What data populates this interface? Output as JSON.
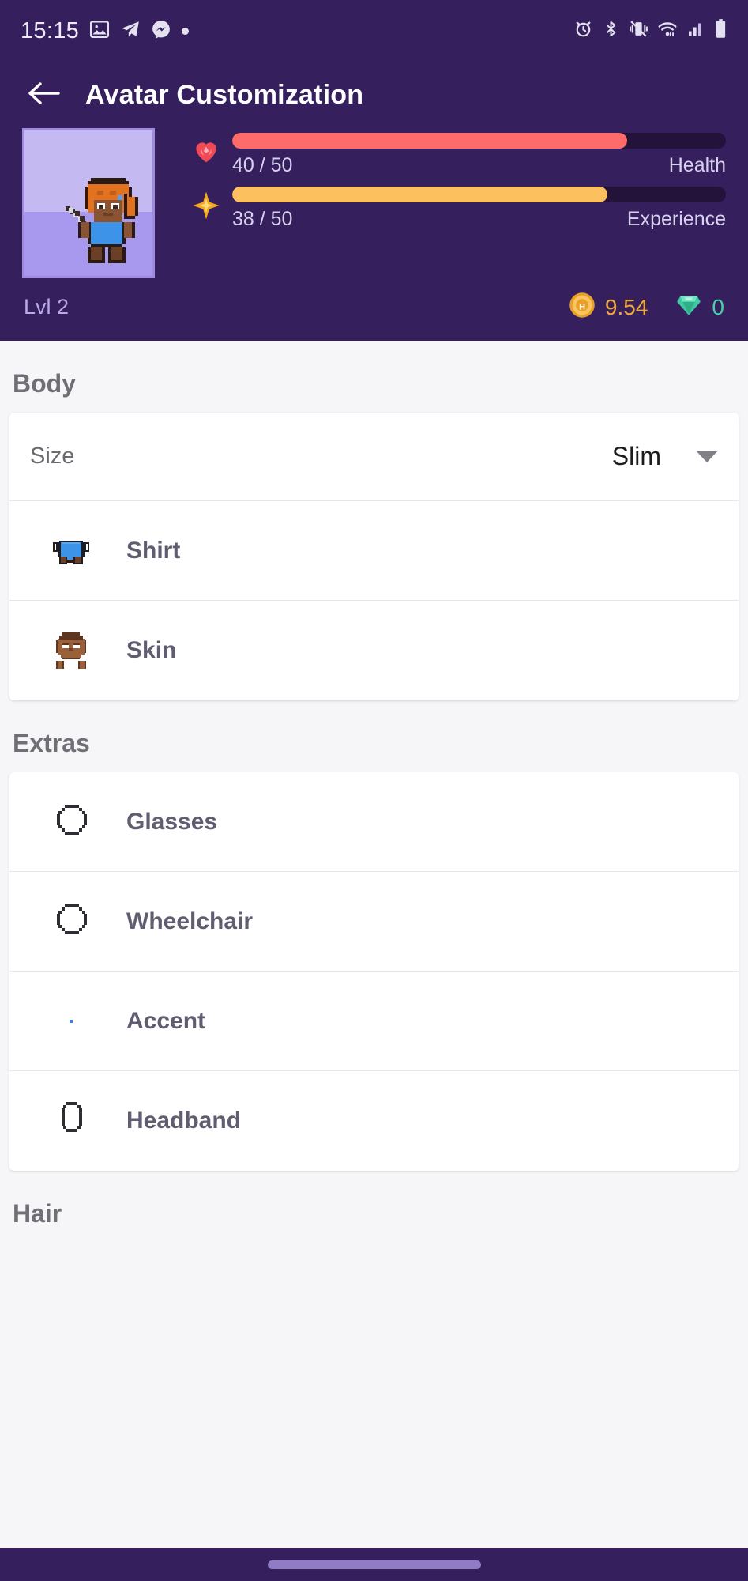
{
  "status_bar": {
    "time": "15:15",
    "left_icons": [
      "photos-icon",
      "telegram-icon",
      "messenger-icon",
      "dot-icon"
    ],
    "right_icons": [
      "alarm-icon",
      "bluetooth-icon",
      "vibrate-icon",
      "wifi-icon",
      "signal-icon",
      "battery-icon"
    ]
  },
  "header": {
    "back_icon": "back-arrow-icon",
    "title": "Avatar Customization",
    "background_color": "#35205d",
    "avatar": {
      "name": "avatar-preview",
      "border_color": "#9f8ae0",
      "bg_top_color": "#c5b9f2",
      "bg_bottom_color": "#a899ee"
    },
    "stats": [
      {
        "icon": "heart-icon",
        "value_text": "40 / 50",
        "label": "Health",
        "current": 40,
        "max": 50,
        "percent": 80,
        "fill_color": "#ff6b6b",
        "track_color": "#231239"
      },
      {
        "icon": "sparkle-icon",
        "value_text": "38 / 50",
        "label": "Experience",
        "current": 38,
        "max": 50,
        "percent": 76,
        "fill_color": "#fcc05e",
        "track_color": "#231239"
      }
    ],
    "level_text": "Lvl 2",
    "currency": [
      {
        "icon": "gold-coin-icon",
        "value": "9.54",
        "color": "#f0a83a"
      },
      {
        "icon": "gem-icon",
        "value": "0",
        "color": "#49cfa4"
      }
    ]
  },
  "sections": [
    {
      "title": "Body",
      "rows": [
        {
          "type": "select",
          "label": "Size",
          "value": "Slim",
          "caret_icon": "chevron-down-icon"
        },
        {
          "type": "item",
          "label": "Shirt",
          "icon": "shirt-sprite-icon"
        },
        {
          "type": "item",
          "label": "Skin",
          "icon": "skin-sprite-icon"
        }
      ]
    },
    {
      "title": "Extras",
      "rows": [
        {
          "type": "item",
          "label": "Glasses",
          "icon": "empty-octagon-icon"
        },
        {
          "type": "item",
          "label": "Wheelchair",
          "icon": "empty-octagon-icon"
        },
        {
          "type": "item",
          "label": "Accent",
          "icon": "blue-dot-icon"
        },
        {
          "type": "item",
          "label": "Headband",
          "icon": "empty-oval-icon"
        }
      ]
    },
    {
      "title": "Hair",
      "rows": []
    }
  ],
  "nav_bar": {
    "handle": "home-indicator"
  }
}
